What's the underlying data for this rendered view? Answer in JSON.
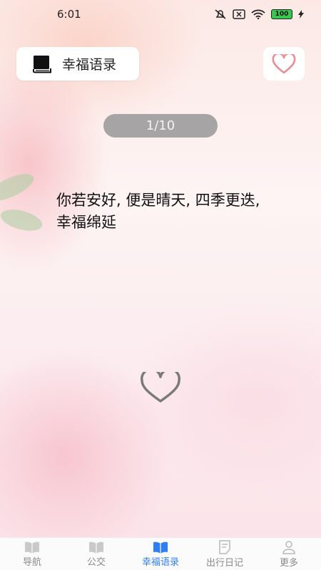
{
  "status_bar": {
    "time": "6:01",
    "battery": "100"
  },
  "header": {
    "title": "幸福语录"
  },
  "counter": "1/10",
  "quote": "你若安好, 便是晴天, 四季更迭, 幸福绵延",
  "tabs": [
    {
      "label": "导航",
      "icon": "book-icon",
      "active": false
    },
    {
      "label": "公交",
      "icon": "book-icon",
      "active": false
    },
    {
      "label": "幸福语录",
      "icon": "book-icon",
      "active": true
    },
    {
      "label": "出行日记",
      "icon": "note-icon",
      "active": false
    },
    {
      "label": "更多",
      "icon": "user-icon",
      "active": false
    }
  ],
  "colors": {
    "accent": "#2f7ff0",
    "heart": "#e98d95",
    "counter_bg": "#a6a4a5"
  }
}
